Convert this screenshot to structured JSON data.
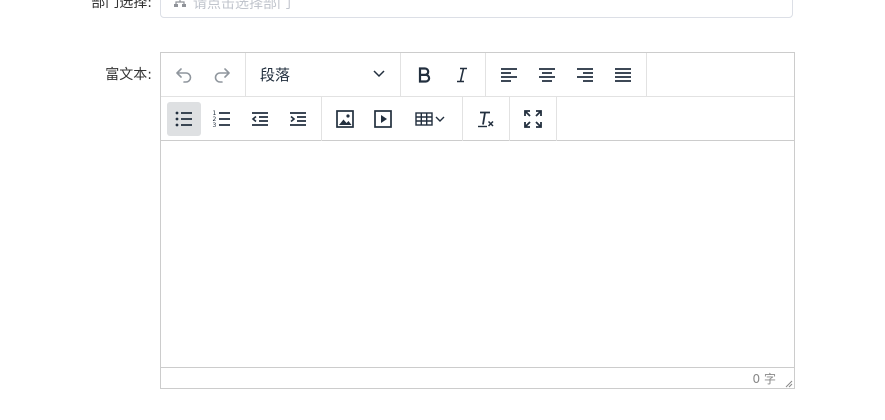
{
  "form": {
    "department": {
      "label": "部门选择:",
      "placeholder": "请点击选择部门"
    },
    "richtext": {
      "label": "富文本:"
    }
  },
  "editor": {
    "block_format": "段落",
    "word_count": "0 字"
  },
  "colors": {
    "icon": "#222f3e",
    "border": "#cccccc",
    "active_bg": "#dee0e2",
    "placeholder": "#c0c4cc"
  },
  "icons": {
    "row1": [
      "undo-icon",
      "redo-icon",
      "chevron-down-icon",
      "bold-icon",
      "italic-icon",
      "align-left-icon",
      "align-center-icon",
      "align-right-icon",
      "align-justify-icon"
    ],
    "row2": [
      "bullet-list-icon",
      "numbered-list-icon",
      "outdent-icon",
      "indent-icon",
      "image-icon",
      "media-icon",
      "table-icon",
      "clear-format-icon",
      "fullscreen-icon"
    ]
  }
}
